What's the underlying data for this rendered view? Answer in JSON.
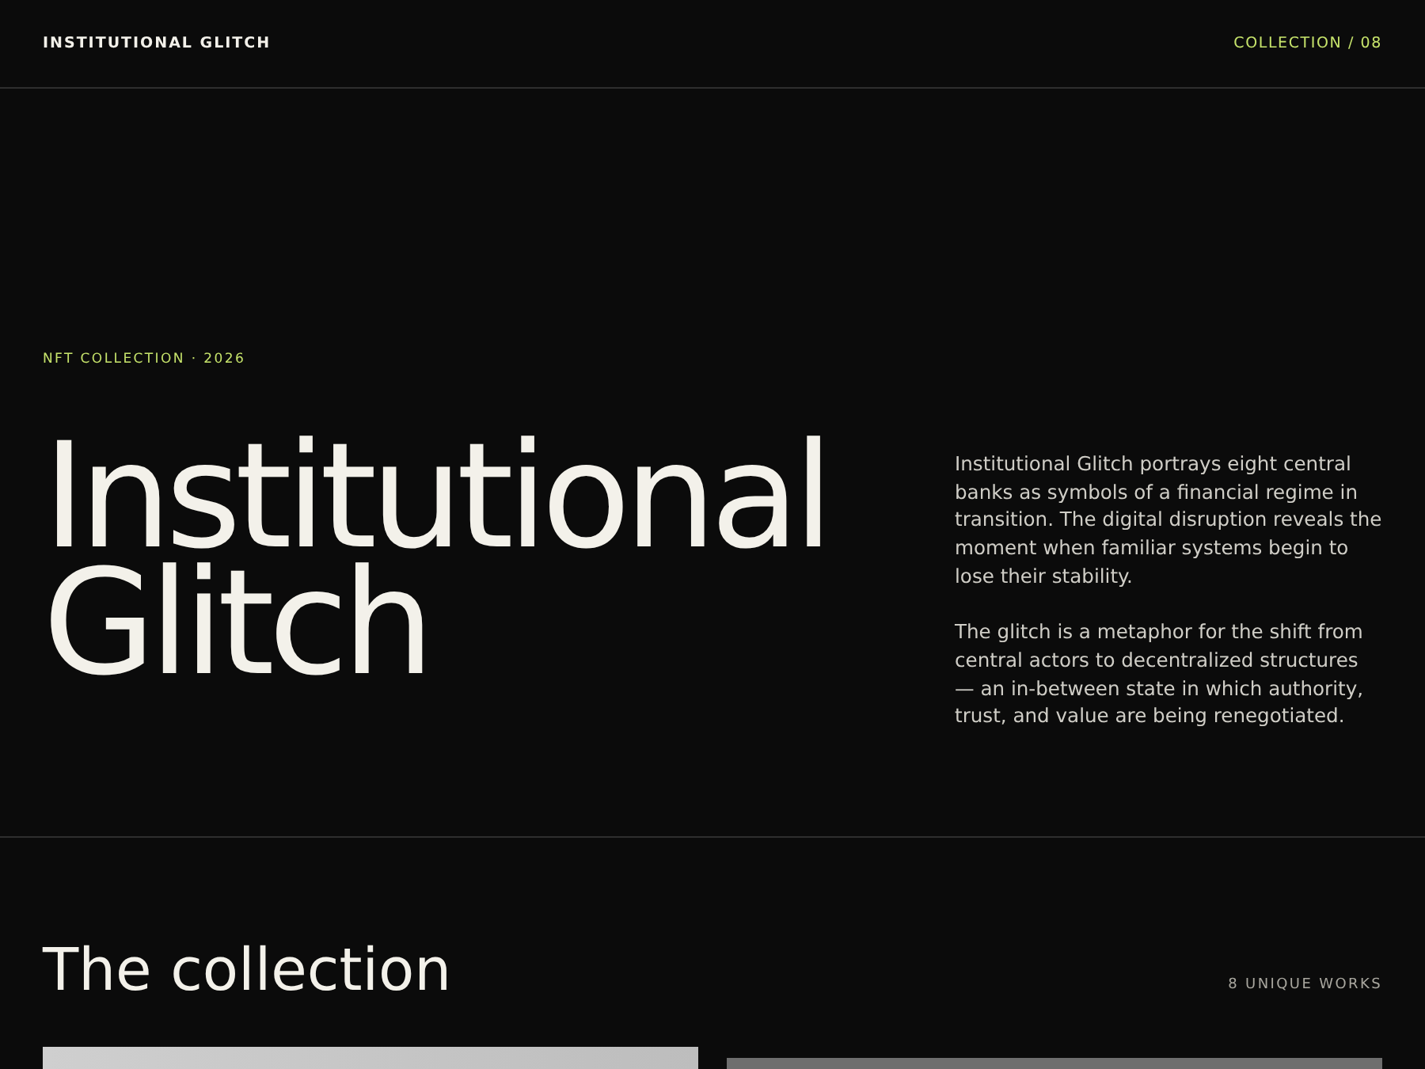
{
  "header": {
    "brand": "INSTITUTIONAL GLITCH",
    "collection_index": "COLLECTION / 08"
  },
  "hero": {
    "eyebrow": "NFT COLLECTION · 2026",
    "title_lines": [
      "Institutional",
      "Glitch"
    ],
    "paragraphs": [
      "Institutional Glitch portrays eight central banks as symbols of a financial regime in transition. The digital disruption reveals the moment when familiar systems begin to lose their stability.",
      "The glitch is a metaphor for the shift from central actors to decentralized structures — an in-between state in which authority, trust, and value are being renegotiated."
    ]
  },
  "collection": {
    "title": "The collection",
    "count": "8 UNIQUE WORKS"
  }
}
